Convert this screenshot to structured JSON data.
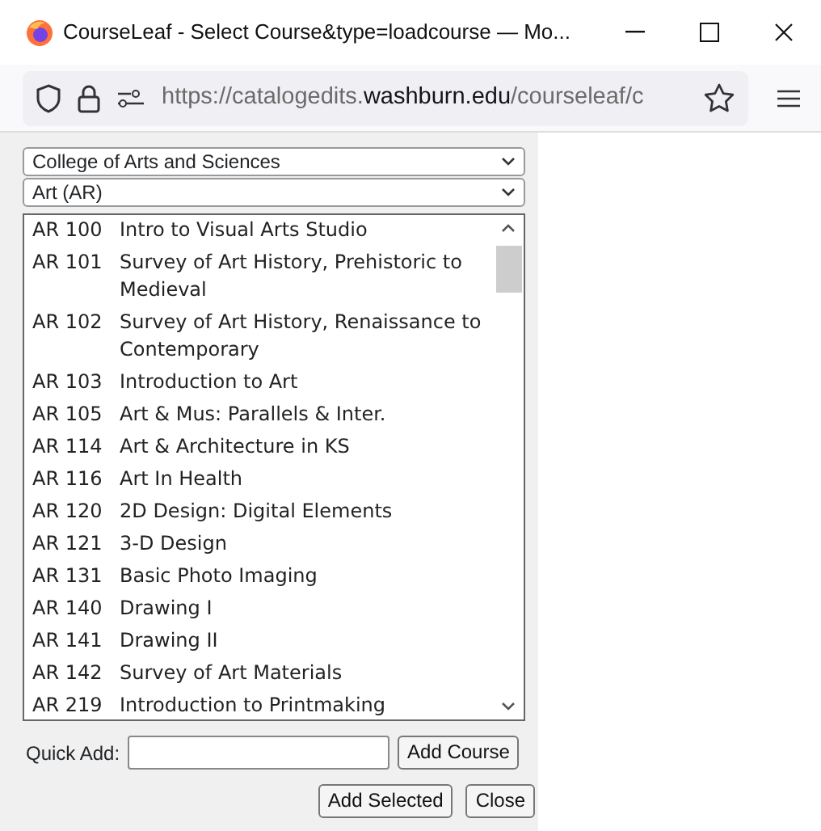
{
  "window": {
    "title": "CourseLeaf - Select Course&type=loadcourse — Mo..."
  },
  "address_bar": {
    "url_start": "https://catalogedits.",
    "url_domain": "washburn.edu",
    "url_end": "/courseleaf/c"
  },
  "college_select": {
    "value": "College of Arts and Sciences"
  },
  "department_select": {
    "value": "Art (AR)"
  },
  "courses": [
    {
      "code": "AR 100",
      "title": "Intro to Visual Arts Studio"
    },
    {
      "code": "AR 101",
      "title": "Survey of Art History, Prehistoric to Medieval"
    },
    {
      "code": "AR 102",
      "title": "Survey of Art History, Renaissance to Contemporary"
    },
    {
      "code": "AR 103",
      "title": "Introduction to Art"
    },
    {
      "code": "AR 105",
      "title": "Art & Mus: Parallels & Inter."
    },
    {
      "code": "AR 114",
      "title": "Art & Architecture in KS"
    },
    {
      "code": "AR 116",
      "title": "Art In Health"
    },
    {
      "code": "AR 120",
      "title": "2D Design: Digital Elements"
    },
    {
      "code": "AR 121",
      "title": "3-D Design"
    },
    {
      "code": "AR 131",
      "title": "Basic Photo Imaging"
    },
    {
      "code": "AR 140",
      "title": "Drawing I"
    },
    {
      "code": "AR 141",
      "title": "Drawing II"
    },
    {
      "code": "AR 142",
      "title": "Survey of Art Materials"
    },
    {
      "code": "AR 219",
      "title": "Introduction to Printmaking"
    }
  ],
  "quick_add": {
    "label": "Quick Add:",
    "button": "Add Course"
  },
  "buttons": [
    "Add Selected",
    "Close"
  ]
}
